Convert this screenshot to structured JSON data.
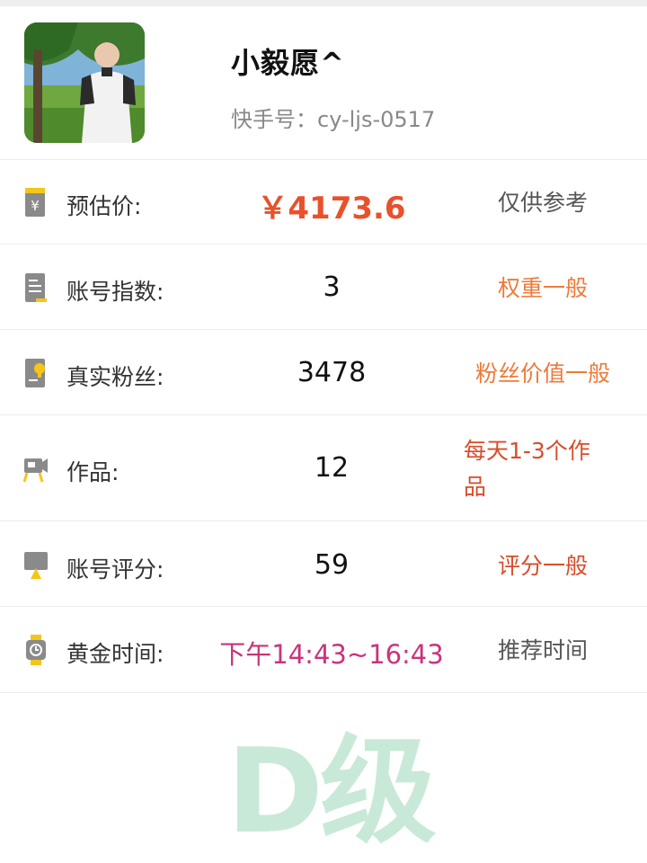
{
  "profile": {
    "nickname": "小毅愿^",
    "account_id": "快手号：cy-ljs-0517"
  },
  "rows": [
    {
      "label": "预估价:",
      "value": "￥4173.6",
      "note": "仅供参考",
      "icon": "price-tag-icon"
    },
    {
      "label": "账号指数:",
      "value": "3",
      "note": "权重一般",
      "icon": "document-icon"
    },
    {
      "label": "真实粉丝:",
      "value": "3478",
      "note": "粉丝价值一般",
      "icon": "fan-badge-icon"
    },
    {
      "label": "作品:",
      "value": "12",
      "note": "每天1-3个作品",
      "icon": "video-camera-icon"
    },
    {
      "label": "账号评分:",
      "value": "59",
      "note": "评分一般",
      "icon": "monitor-icon"
    },
    {
      "label": "黄金时间:",
      "value": "下午14:43~16:43",
      "note": "推荐时间",
      "icon": "watch-icon"
    }
  ],
  "grade": "D级",
  "colors": {
    "price": "#e8512b",
    "note_orange": "#ee7a3a",
    "note_red": "#d84c2a",
    "time": "#c8347c",
    "grade": "#c9e9d8",
    "icon_gray": "#8a8a8a",
    "icon_yellow": "#f5c518"
  }
}
